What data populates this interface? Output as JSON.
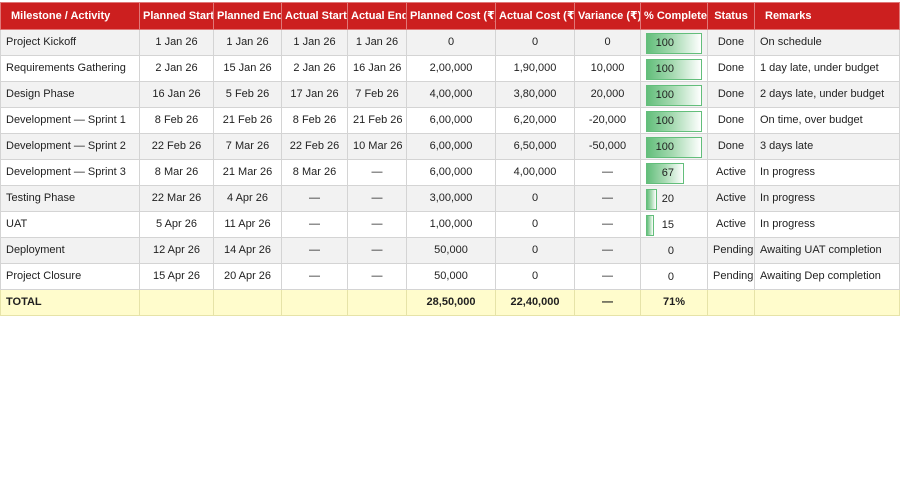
{
  "headers": [
    "Milestone / Activity",
    "Planned Start",
    "Planned End",
    "Actual Start",
    "Actual End",
    "Planned Cost (₹)",
    "Actual Cost (₹)",
    "Variance (₹)",
    "% Complete",
    "Status",
    "Remarks"
  ],
  "rows": [
    {
      "name": "Project Kickoff",
      "ps": "1 Jan 26",
      "pe": "1 Jan 26",
      "as": "1 Jan 26",
      "ae": "1 Jan 26",
      "pc": "0",
      "ac": "0",
      "var": "0",
      "pct": 100,
      "pct_label": "100",
      "status": "Done",
      "remarks": "On schedule"
    },
    {
      "name": "Requirements Gathering",
      "ps": "2 Jan 26",
      "pe": "15 Jan 26",
      "as": "2 Jan 26",
      "ae": "16 Jan 26",
      "pc": "2,00,000",
      "ac": "1,90,000",
      "var": "10,000",
      "pct": 100,
      "pct_label": "100",
      "status": "Done",
      "remarks": "1 day late, under budget"
    },
    {
      "name": "Design Phase",
      "ps": "16 Jan 26",
      "pe": "5 Feb 26",
      "as": "17 Jan 26",
      "ae": "7 Feb 26",
      "pc": "4,00,000",
      "ac": "3,80,000",
      "var": "20,000",
      "pct": 100,
      "pct_label": "100",
      "status": "Done",
      "remarks": "2 days late, under budget"
    },
    {
      "name": "Development — Sprint 1",
      "ps": "8 Feb 26",
      "pe": "21 Feb 26",
      "as": "8 Feb 26",
      "ae": "21 Feb 26",
      "pc": "6,00,000",
      "ac": "6,20,000",
      "var": "-20,000",
      "pct": 100,
      "pct_label": "100",
      "status": "Done",
      "remarks": "On time, over budget"
    },
    {
      "name": "Development — Sprint 2",
      "ps": "22 Feb 26",
      "pe": "7 Mar 26",
      "as": "22 Feb 26",
      "ae": "10 Mar 26",
      "pc": "6,00,000",
      "ac": "6,50,000",
      "var": "-50,000",
      "pct": 100,
      "pct_label": "100",
      "status": "Done",
      "remarks": "3 days late"
    },
    {
      "name": "Development — Sprint 3",
      "ps": "8 Mar 26",
      "pe": "21 Mar 26",
      "as": "8 Mar 26",
      "ae": "—",
      "pc": "6,00,000",
      "ac": "4,00,000",
      "var": "—",
      "pct": 67,
      "pct_label": "67",
      "status": "Active",
      "remarks": "In progress"
    },
    {
      "name": "Testing Phase",
      "ps": "22 Mar 26",
      "pe": "4 Apr 26",
      "as": "—",
      "ae": "—",
      "pc": "3,00,000",
      "ac": "0",
      "var": "—",
      "pct": 20,
      "pct_label": "20",
      "status": "Active",
      "remarks": "In progress"
    },
    {
      "name": "UAT",
      "ps": "5 Apr 26",
      "pe": "11 Apr 26",
      "as": "—",
      "ae": "—",
      "pc": "1,00,000",
      "ac": "0",
      "var": "—",
      "pct": 15,
      "pct_label": "15",
      "status": "Active",
      "remarks": "In progress"
    },
    {
      "name": "Deployment",
      "ps": "12 Apr 26",
      "pe": "14 Apr 26",
      "as": "—",
      "ae": "—",
      "pc": "50,000",
      "ac": "0",
      "var": "—",
      "pct": 0,
      "pct_label": "0",
      "status": "Pending",
      "remarks": "Awaiting UAT completion"
    },
    {
      "name": "Project Closure",
      "ps": "15 Apr 26",
      "pe": "20 Apr 26",
      "as": "—",
      "ae": "—",
      "pc": "50,000",
      "ac": "0",
      "var": "—",
      "pct": 0,
      "pct_label": "0",
      "status": "Pending",
      "remarks": "Awaiting Dep completion"
    }
  ],
  "total": {
    "name": "TOTAL",
    "ps": "",
    "pe": "",
    "as": "",
    "ae": "",
    "pc": "28,50,000",
    "ac": "22,40,000",
    "var": "—",
    "pct": "71%",
    "status": "",
    "remarks": ""
  },
  "colors": {
    "header_bg": "#cc1f1f",
    "header_text": "#ffffff",
    "bar_green": "#63be7b",
    "total_bg": "#fffccc",
    "stripe": "#f2f2f2"
  }
}
